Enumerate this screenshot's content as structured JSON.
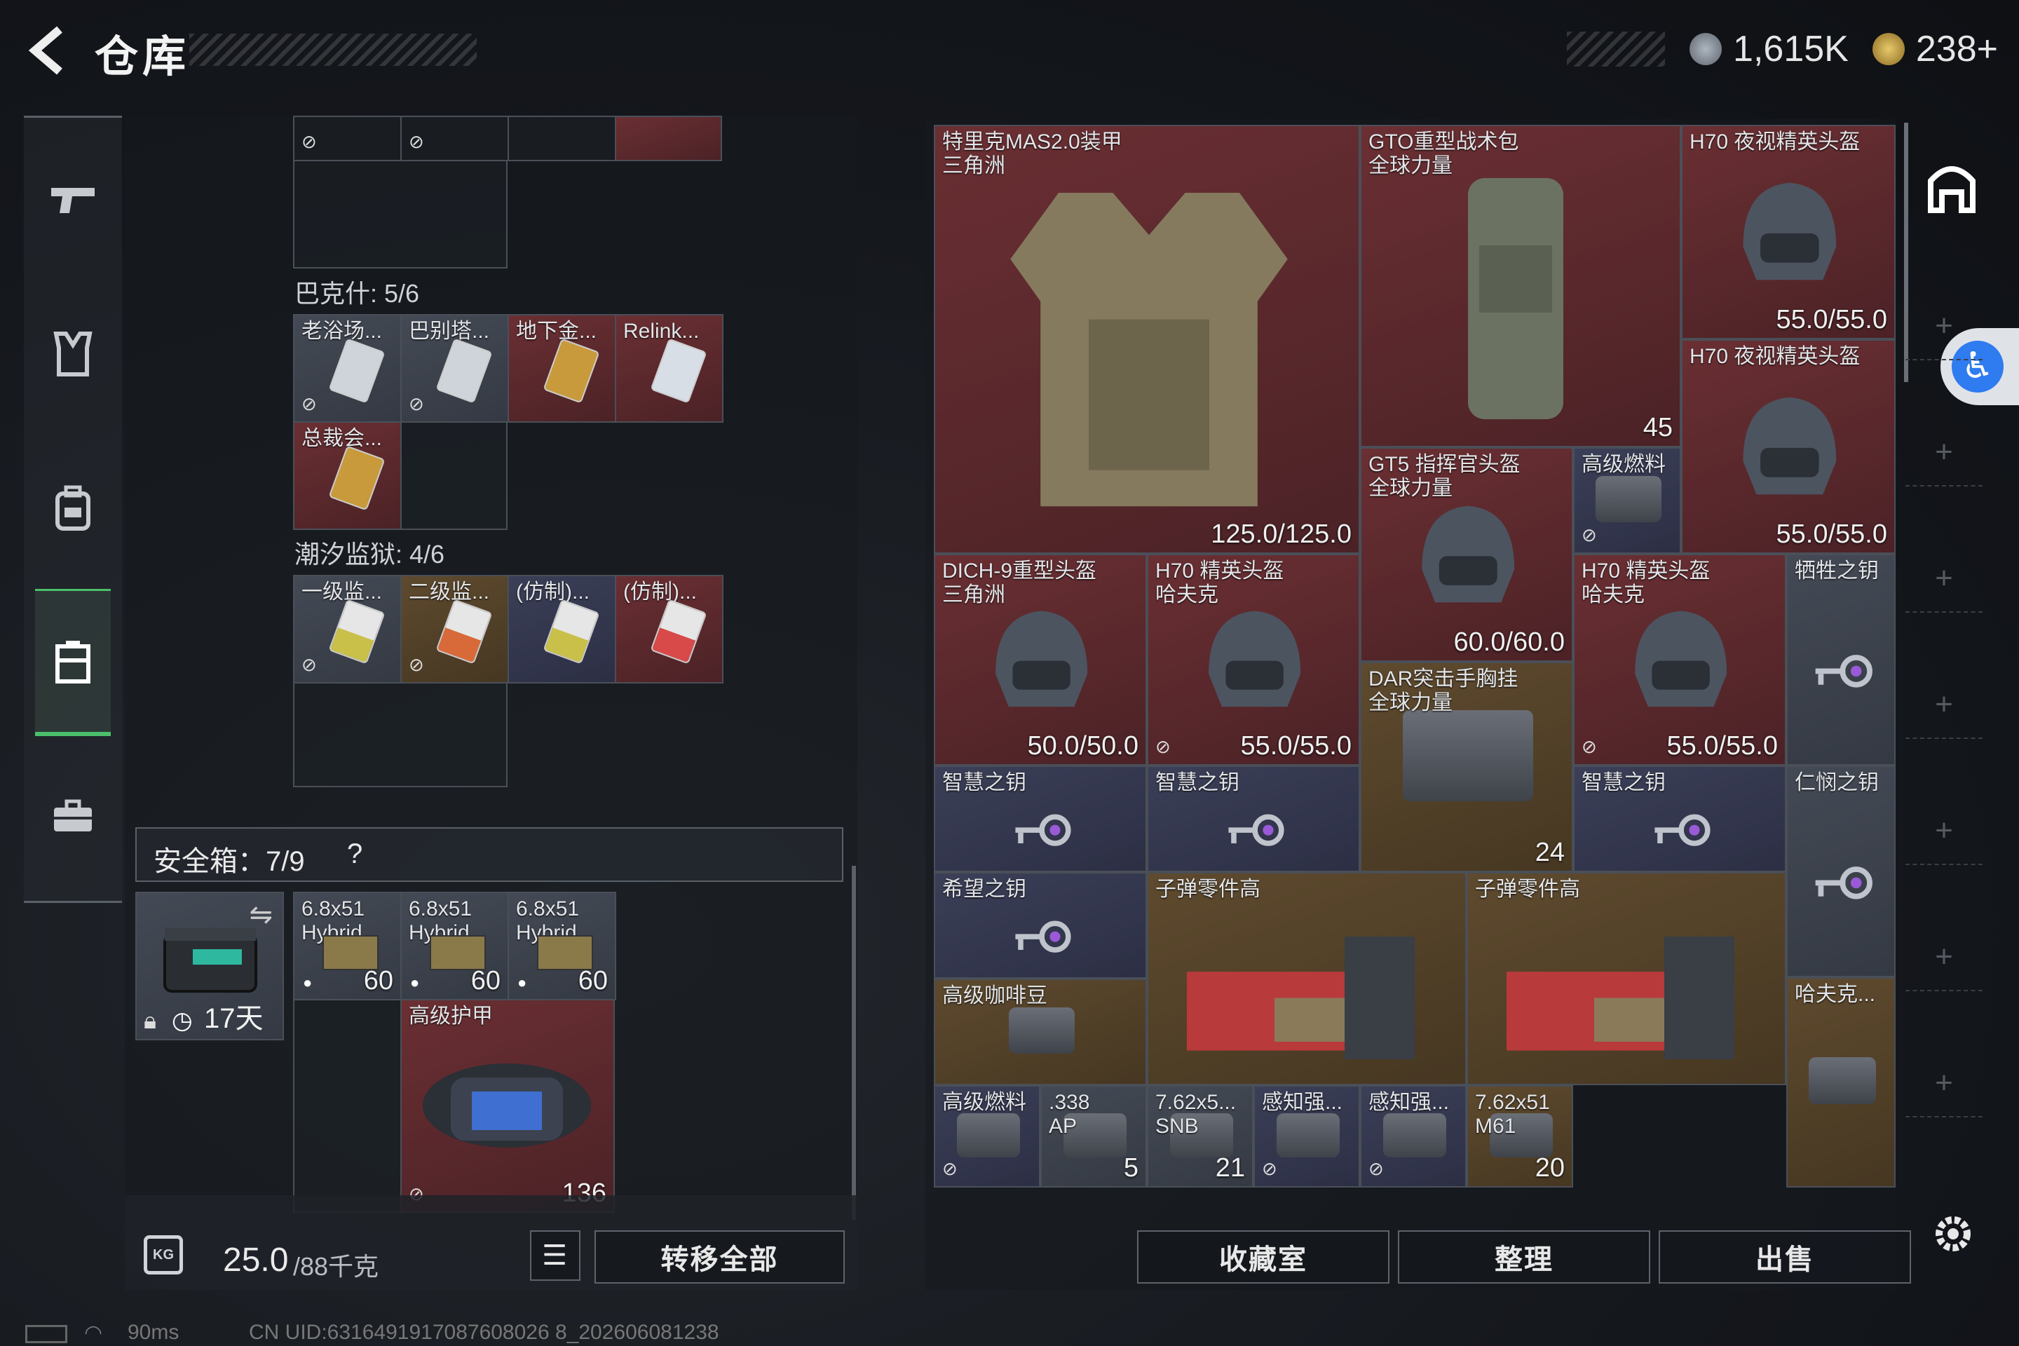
{
  "header": {
    "title": "仓库",
    "currency_1": "1,615K",
    "currency_2": "238+"
  },
  "colors": {
    "accent_green": "#4bbf6a",
    "cell_red": "#5a282c",
    "cell_blue": "#33364d",
    "cell_gold": "#51402a"
  },
  "nav": {
    "items": [
      "gun-icon",
      "armor-icon",
      "backpack-icon",
      "chest-rig-icon",
      "briefcase-icon"
    ],
    "active": "chest-rig-icon"
  },
  "left": {
    "top_cells": [
      {
        "label": ""
      },
      {
        "label": ""
      },
      {
        "label": ""
      },
      {
        "label": ""
      }
    ],
    "section1": {
      "title": "巴克什: 5/6",
      "cards": [
        "老浴场...",
        "巴别塔...",
        "地下金...",
        "Relink...",
        "总裁会..."
      ]
    },
    "section2": {
      "title": "潮汐监狱: 4/6",
      "cards": [
        "一级监...",
        "二级监...",
        "(仿制)...",
        "(仿制)..."
      ]
    },
    "safe_box": {
      "title": "安全箱：7/9",
      "help": "?",
      "item_time": "17天"
    },
    "ammo": [
      {
        "name": "6.8x51",
        "sub": "Hybrid",
        "count": "60"
      },
      {
        "name": "6.8x51",
        "sub": "Hybrid",
        "count": "60"
      },
      {
        "name": "6.8x51",
        "sub": "Hybrid",
        "count": "60"
      }
    ],
    "armor_bag": {
      "name": "高级护甲",
      "value": "136"
    },
    "weight": {
      "current": "25.0",
      "max": "/88千克"
    },
    "transfer_label": "转移全部"
  },
  "right": {
    "items": [
      {
        "id": "vest",
        "name": "特里克MAS2.0装甲",
        "sub": "三角洲",
        "value": "125.0/125.0"
      },
      {
        "id": "backpack",
        "name": "GTO重型战术包",
        "sub": "全球力量",
        "value": "45"
      },
      {
        "id": "nv1",
        "name": "H70 夜视精英头盔",
        "sub": "",
        "value": "55.0/55.0"
      },
      {
        "id": "nv2",
        "name": "H70 夜视精英头盔",
        "sub": "",
        "value": "55.0/55.0"
      },
      {
        "id": "gt5",
        "name": "GT5 指挥官头盔",
        "sub": "全球力量",
        "value": "60.0/60.0"
      },
      {
        "id": "fuel1",
        "name": "高级燃料",
        "sub": "",
        "value": ""
      },
      {
        "id": "dich",
        "name": "DICH-9重型头盔",
        "sub": "三角洲",
        "value": "50.0/50.0"
      },
      {
        "id": "h70a",
        "name": "H70 精英头盔",
        "sub": "哈夫克",
        "value": "55.0/55.0"
      },
      {
        "id": "h70b",
        "name": "H70 精英头盔",
        "sub": "哈夫克",
        "value": "55.0/55.0"
      },
      {
        "id": "sacrifice",
        "name": "牺牲之钥",
        "sub": "",
        "value": ""
      },
      {
        "id": "dar",
        "name": "DAR突击手胸挂",
        "sub": "全球力量",
        "value": "24"
      },
      {
        "id": "wis1",
        "name": "智慧之钥",
        "sub": "",
        "value": ""
      },
      {
        "id": "wis2",
        "name": "智慧之钥",
        "sub": "",
        "value": ""
      },
      {
        "id": "wis3",
        "name": "智慧之钥",
        "sub": "",
        "value": ""
      },
      {
        "id": "mercy",
        "name": "仁悯之钥",
        "sub": "",
        "value": ""
      },
      {
        "id": "hope",
        "name": "希望之钥",
        "sub": "",
        "value": ""
      },
      {
        "id": "parts1",
        "name": "子弹零件高",
        "sub": "",
        "value": ""
      },
      {
        "id": "parts2",
        "name": "子弹零件高",
        "sub": "",
        "value": ""
      },
      {
        "id": "coffee",
        "name": "高级咖啡豆",
        "sub": "",
        "value": ""
      },
      {
        "id": "haf",
        "name": "哈夫克...",
        "sub": "",
        "value": ""
      },
      {
        "id": "fuel2",
        "name": "高级燃料",
        "sub": "",
        "value": ""
      },
      {
        "id": "ap338",
        "name": ".338",
        "sub": "AP",
        "value": "5"
      },
      {
        "id": "snb",
        "name": "7.62x5...",
        "sub": "SNB",
        "value": "21"
      },
      {
        "id": "sense1",
        "name": "感知强...",
        "sub": "",
        "value": ""
      },
      {
        "id": "sense2",
        "name": "感知强...",
        "sub": "",
        "value": ""
      },
      {
        "id": "m61",
        "name": "7.62x51",
        "sub": "M61",
        "value": "20"
      }
    ],
    "buttons": {
      "collection": "收藏室",
      "sort": "整理",
      "sell": "出售"
    }
  },
  "status": {
    "ping": "90ms",
    "uid": "CN UID:6316491917087608026 8_202606081238"
  }
}
